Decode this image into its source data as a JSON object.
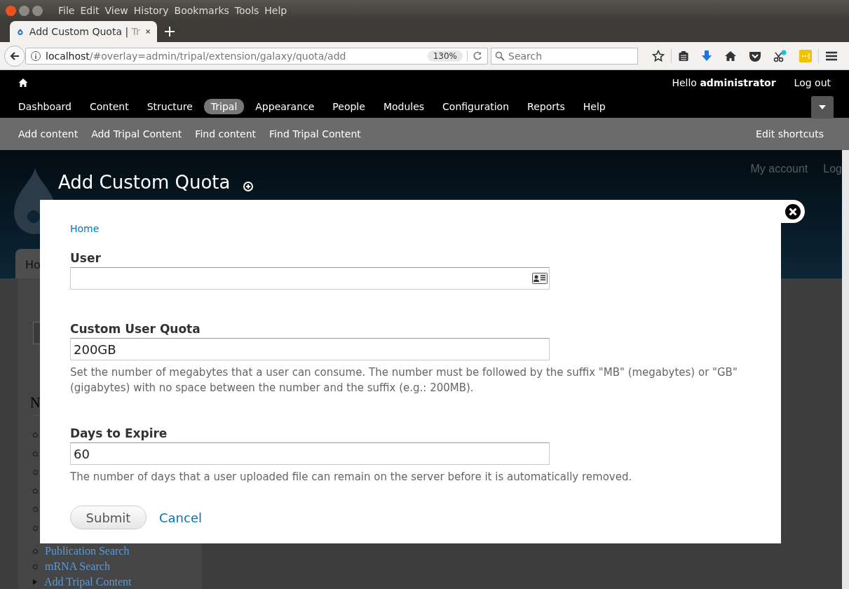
{
  "browser": {
    "menu": [
      "File",
      "Edit",
      "View",
      "History",
      "Bookmarks",
      "Tools",
      "Help"
    ],
    "tab": {
      "title": "Add Custom Quota | ",
      "title_faded": "Tr"
    },
    "url": {
      "host": "localhost",
      "path": "/#overlay=admin/tripal/extension/galaxy/quota/add"
    },
    "zoom": "130%",
    "search": {
      "placeholder": "Search"
    }
  },
  "toolbar": {
    "greeting": "Hello **administrator**",
    "logout": "Log out",
    "menu": [
      {
        "label": "Dashboard",
        "selected": false
      },
      {
        "label": "Content",
        "selected": false
      },
      {
        "label": "Structure",
        "selected": false
      },
      {
        "label": "Tripal",
        "selected": true
      },
      {
        "label": "Appearance",
        "selected": false
      },
      {
        "label": "People",
        "selected": false
      },
      {
        "label": "Modules",
        "selected": false
      },
      {
        "label": "Configuration",
        "selected": false
      },
      {
        "label": "Reports",
        "selected": false
      },
      {
        "label": "Help",
        "selected": false
      }
    ],
    "shortcuts": [
      "Add content",
      "Add Tripal Content",
      "Find content",
      "Find Tripal Content"
    ],
    "edit_shortcuts": "Edit shortcuts"
  },
  "site": {
    "links": [
      "My account",
      "Log"
    ],
    "tab": "Ho",
    "block_title": "N",
    "nav": [
      {
        "label": "Publication Search",
        "kind": "leaf"
      },
      {
        "label": "mRNA Search",
        "kind": "leaf"
      },
      {
        "label": "Add Tripal Content",
        "kind": "collapsed"
      }
    ]
  },
  "overlay": {
    "title": "Add Custom Quota",
    "breadcrumb": "Home",
    "fields": [
      {
        "label": "User",
        "kind": "autocomplete"
      },
      {
        "label": "Custom User Quota",
        "value": "200GB",
        "kind": "text",
        "description": "Set the number of megabytes that a user can consume. The number must be followed by the suffix \"MB\" (megabytes) or \"GB\" (gigabytes) with no space between the number and the suffix (e.g.: 200MB)."
      },
      {
        "label": "Days to Expire",
        "value": "60",
        "kind": "text",
        "description": "The number of days that a user uploaded file can remain on the server before it is automatically removed."
      }
    ],
    "submit": "Submit",
    "cancel": "Cancel"
  }
}
